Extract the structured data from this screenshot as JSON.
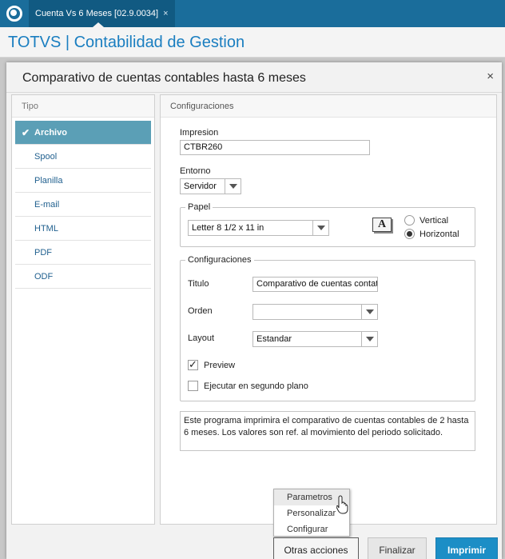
{
  "window": {
    "tab_title": "Cuenta Vs 6 Meses [02.9.0034]",
    "tab_close": "×"
  },
  "app": {
    "title": "TOTVS | Contabilidad de Gestion"
  },
  "dialog": {
    "title": "Comparativo de cuentas contables hasta 6 meses",
    "close": "×"
  },
  "tipo": {
    "header": "Tipo",
    "items": [
      {
        "label": "Archivo",
        "selected": true
      },
      {
        "label": "Spool"
      },
      {
        "label": "Planilla"
      },
      {
        "label": "E-mail"
      },
      {
        "label": "HTML"
      },
      {
        "label": "PDF"
      },
      {
        "label": "ODF"
      }
    ]
  },
  "config": {
    "header": "Configuraciones",
    "impresion_label": "Impresion",
    "impresion_value": "CTBR260",
    "entorno_label": "Entorno",
    "entorno_value": "Servidor",
    "papel": {
      "legend": "Papel",
      "size": "Letter 8 1/2 x 11 in",
      "font_icon": "A",
      "vertical": "Vertical",
      "horizontal": "Horizontal",
      "orientation": "Horizontal"
    },
    "group": {
      "legend": "Configuraciones",
      "titulo_label": "Titulo",
      "titulo_value": "Comparativo de cuentas contat",
      "orden_label": "Orden",
      "orden_value": "",
      "layout_label": "Layout",
      "layout_value": "Estandar",
      "preview_label": "Preview",
      "preview_checked": true,
      "background_label": "Ejecutar en segundo plano",
      "background_checked": false
    },
    "description": "Este programa imprimira el comparativo de cuentas contables de 2 hasta 6 meses. Los valores son ref. al movimiento del periodo solicitado."
  },
  "menu": {
    "items": [
      "Parametros",
      "Personalizar",
      "Configurar"
    ]
  },
  "buttons": {
    "other": "Otras acciones",
    "finalize": "Finalizar",
    "print": "Imprimir"
  },
  "colors": {
    "brand": "#1a6d9b",
    "accent": "#1c8ec6",
    "selected_row": "#5b9fb6"
  }
}
